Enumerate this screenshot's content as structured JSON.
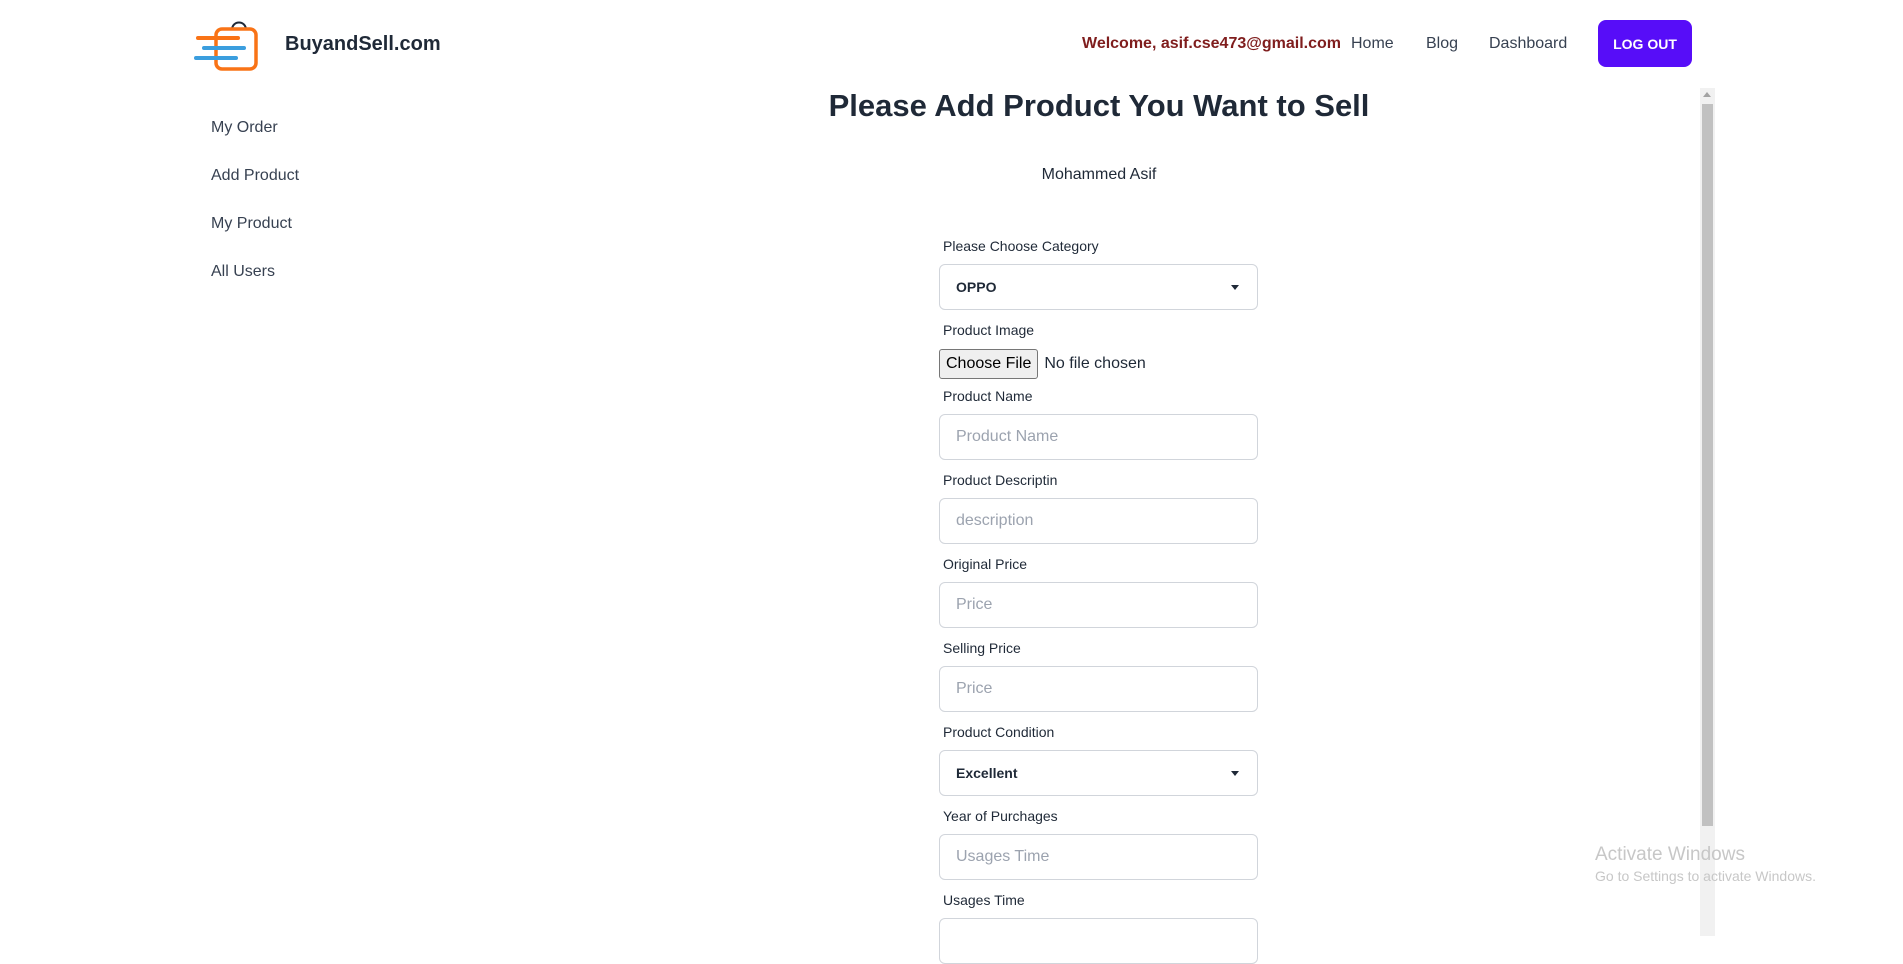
{
  "navbar": {
    "brand": "BuyandSell.com",
    "welcome": "Welcome, asif.cse473@gmail.com",
    "links": [
      "Home",
      "Blog",
      "Dashboard"
    ],
    "logout": "LOG OUT",
    "accent": "#570df8"
  },
  "sidebar": {
    "items": [
      "My Order",
      "Add Product",
      "My Product",
      "All Users"
    ]
  },
  "main": {
    "title": "Please Add Product You Want to Sell",
    "user_name": "Mohammed Asif"
  },
  "form": {
    "category_label": "Please Choose Category",
    "category_value": "OPPO",
    "image_label": "Product Image",
    "file_button": "Choose File",
    "file_status": "No file chosen",
    "name_label": "Product Name",
    "name_placeholder": "Product Name",
    "desc_label": "Product Descriptin",
    "desc_placeholder": "description",
    "original_label": "Original Price",
    "original_placeholder": "Price",
    "selling_label": "Selling Price",
    "selling_placeholder": "Price",
    "condition_label": "Product Condition",
    "condition_value": "Excellent",
    "year_label": "Year of Purchages",
    "year_placeholder": "Usages Time",
    "usage_label": "Usages Time"
  },
  "watermark": {
    "title": "Activate Windows",
    "subtitle": "Go to Settings to activate Windows."
  }
}
